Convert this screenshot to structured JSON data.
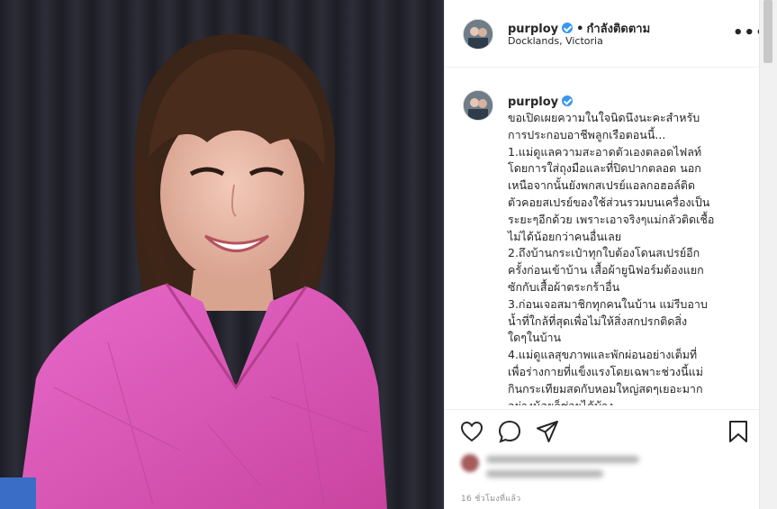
{
  "post": {
    "username": "purploy",
    "follow_status": "กำลังติดตาม",
    "location": "Docklands, Victoria",
    "more_icon": "more-options-icon",
    "caption_username": "purploy",
    "caption": "ขอเปิดเผยความในใจนิดนึงนะคะสำหรับ\nการประกอบอาชีพลูกเรือตอนนี้...\n1.แม่ดูแลความสะอาดตัวเองตลอดไฟลท์\nโดยการใส่ถุงมือและที่ปิดปากตลอด นอก\nเหนือจากนั้นยังพกสเปรย์แอลกอฮอล์ติด\nตัวคอยสเปรย์ของใช้ส่วนรวมบนเครื่องเป็น\nระยะๆอีกด้วย เพราะเอาจริงๆแม่กลัวติดเชื้อ\nไม่ได้น้อยกว่าคนอื่นเลย\n2.ถึงบ้านกระเป๋าทุกใบต้องโดนสเปรย์อีก\nครั้งก่อนเข้าบ้าน เสื้อผ้ายูนิฟอร์มต้องแยก\nซักกับเสื้อผ้าตระกร้าอื่น\n3.ก่อนเจอสมาชิกทุกคนในบ้าน แม่รีบอาบ\nน้ำที่ใกล้ที่สุดเพื่อไม่ให้สิ่งสกปรกติดสิ่ง\nใดๆในบ้าน\n4.แม่ดูแลสุขภาพและพักผ่อนอย่างเต็มที่\nเพื่อร่างกายที่แข็งแรงโดยเฉพาะช่วงนี้แม่\nกินกระเทียมสดกับหอมใหญ่สดๆเยอะมาก\nอย่างน้อยก็ช่วยได้บ้าง",
    "time_ago": "16 ชั่วโมงที่แล้ว",
    "icons": {
      "like": "heart-icon",
      "comment": "comment-icon",
      "share": "share-icon",
      "save": "bookmark-icon"
    }
  },
  "colors": {
    "blouse": "#e05bbf",
    "background": "#2a2a33",
    "verified": "#3897f0"
  }
}
